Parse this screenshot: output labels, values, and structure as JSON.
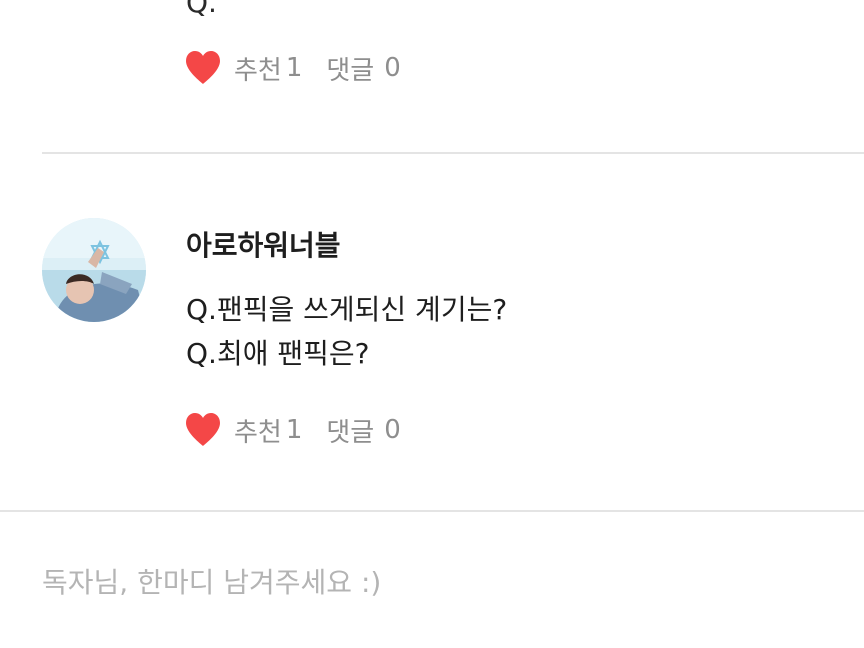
{
  "previous_comment": {
    "cutoff_text": "Q.",
    "likes_label": "추천",
    "likes_count": "1",
    "comments_label": "댓글",
    "comments_count": "0"
  },
  "comment": {
    "author": "아로하워너블",
    "lines": [
      "Q.팬픽을 쓰게되신 계기는?",
      "Q.최애 팬픽은?"
    ],
    "likes_label": "추천",
    "likes_count": "1",
    "comments_label": "댓글",
    "comments_count": "0"
  },
  "reply": {
    "placeholder": "독자님, 한마디 남겨주세요 :)"
  },
  "colors": {
    "heart": "#f44747",
    "muted_text": "#8e8e8e",
    "divider": "#e4e4e4",
    "placeholder": "#b4b4b4"
  },
  "icons": {
    "like": "heart-icon",
    "avatar": "profile-avatar"
  }
}
